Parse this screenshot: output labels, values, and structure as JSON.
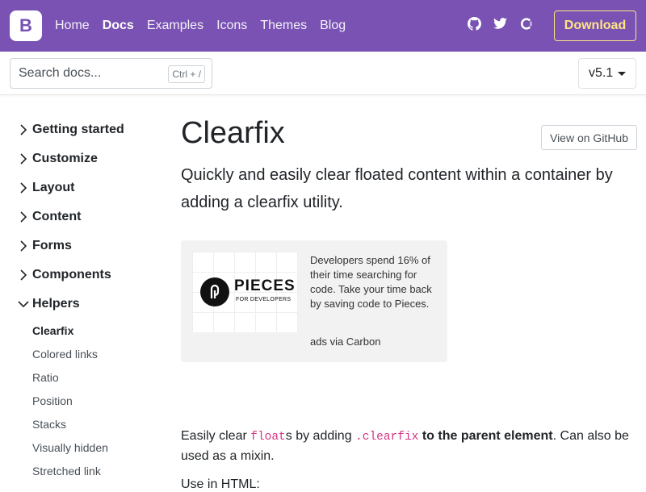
{
  "navbar": {
    "brand": "B",
    "links": [
      "Home",
      "Docs",
      "Examples",
      "Icons",
      "Themes",
      "Blog"
    ],
    "active_link": "Docs",
    "icons": [
      "github-icon",
      "twitter-icon",
      "opencollective-icon"
    ],
    "download_label": "Download",
    "accent": "#7952b3",
    "download_color": "#ffe484"
  },
  "subbar": {
    "search_placeholder": "Search docs...",
    "search_shortcut": "Ctrl + /",
    "version": "v5.1"
  },
  "sidebar": {
    "groups": [
      {
        "label": "Getting started",
        "expanded": false
      },
      {
        "label": "Customize",
        "expanded": false
      },
      {
        "label": "Layout",
        "expanded": false
      },
      {
        "label": "Content",
        "expanded": false
      },
      {
        "label": "Forms",
        "expanded": false
      },
      {
        "label": "Components",
        "expanded": false
      },
      {
        "label": "Helpers",
        "expanded": true
      }
    ],
    "helpers_items": [
      "Clearfix",
      "Colored links",
      "Ratio",
      "Position",
      "Stacks",
      "Visually hidden",
      "Stretched link"
    ],
    "active_item": "Clearfix"
  },
  "main": {
    "title": "Clearfix",
    "github_button": "View on GitHub",
    "lead": "Quickly and easily clear floated content within a container by adding a clearfix utility.",
    "ad": {
      "brand_name": "PIECES",
      "brand_tag": "FOR DEVELOPERS",
      "text": "Developers spend 16% of their time searching for code. Take your time back by saving code to Pieces.",
      "via": "ads via Carbon"
    },
    "body": {
      "part1": "Easily clear ",
      "code1": "float",
      "part2": "s by adding ",
      "code2": ".clearfix",
      "part3": " to the parent element",
      "part4": ". Can also be used as a mixin."
    },
    "cut_text": "Use in HTML:"
  }
}
